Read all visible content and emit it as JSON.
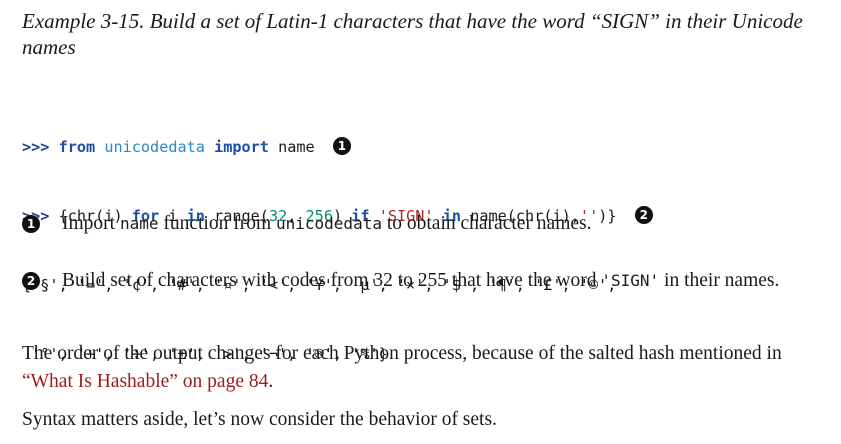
{
  "caption": "Example 3-15. Build a set of Latin-1 characters that have the word “SIGN” in their Unicode names",
  "code": {
    "prompt": ">>>",
    "line1": {
      "kw_from": "from",
      "module": "unicodedata",
      "kw_import": "import",
      "name": "name",
      "callout": "1"
    },
    "line2": {
      "open": "{chr(i) ",
      "kw_for": "for",
      "var": " i ",
      "kw_in": "in",
      "call_open": " range(",
      "n1": "32",
      "sep": ", ",
      "n2": "256",
      "call_close": ") ",
      "kw_if": "if",
      "sp": " ",
      "str_sign": "'SIGN'",
      "sp2": " ",
      "kw_in2": "in",
      "tail_a": " name(chr(i),",
      "empty_str": "''",
      "tail_b": ")}",
      "callout": "2"
    },
    "output_line1": "{'§', '=', '¢', '#', '¤', '<', '¥', 'µ', '×', '$', '¶', '£', '©',",
    "output_line2": " '°', '+', '÷', '±', '>', '¬', '®', '%'}"
  },
  "notes": [
    {
      "callout": "1",
      "pre": "Import ",
      "code1": "name",
      "mid": " function from ",
      "code2": "unicodedata",
      "post": " to obtain character names."
    },
    {
      "callout": "2",
      "pre": "Build set of characters with codes from 32 to 255 that have the word ",
      "code1": "'SIGN'",
      "post": " in their names."
    }
  ],
  "paragraph1": {
    "pre": "The order of the output changes for each Python process, because of the salted hash mentioned in ",
    "link": "“What Is Hashable” on page 84",
    "post": "."
  },
  "paragraph2": "Syntax matters aside, let’s now consider the behavior of sets."
}
